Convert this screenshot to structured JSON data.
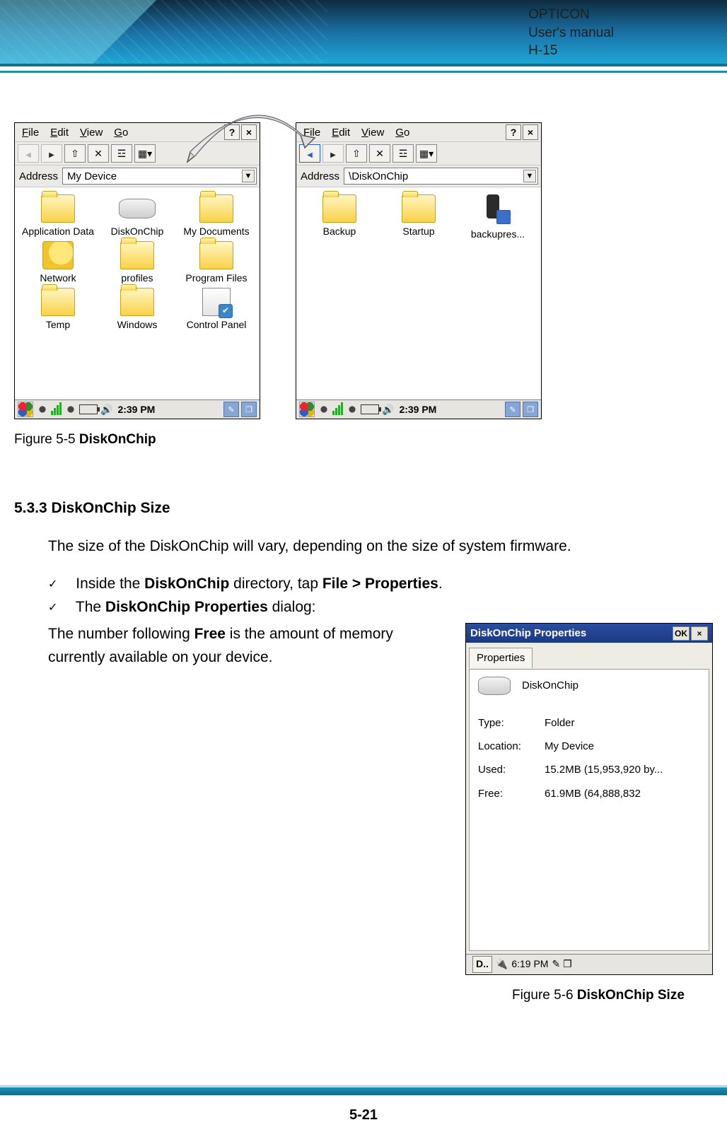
{
  "header": {
    "line1": "OPTICON",
    "line2": "User's manual",
    "line3": "H-15"
  },
  "explorer_left": {
    "menu": {
      "file": "File",
      "edit": "Edit",
      "view": "View",
      "go": "Go"
    },
    "address_label": "Address",
    "address_value": "My Device",
    "items": [
      {
        "label": "Application Data",
        "kind": "folder",
        "selected": true
      },
      {
        "label": "DiskOnChip",
        "kind": "disk"
      },
      {
        "label": "My Documents",
        "kind": "folder"
      },
      {
        "label": "Network",
        "kind": "net"
      },
      {
        "label": "profiles",
        "kind": "folder"
      },
      {
        "label": "Program Files",
        "kind": "folder"
      },
      {
        "label": "Temp",
        "kind": "folder"
      },
      {
        "label": "Windows",
        "kind": "folder"
      },
      {
        "label": "Control Panel",
        "kind": "cpanel"
      }
    ],
    "taskbar_time": "2:39 PM"
  },
  "explorer_right": {
    "menu": {
      "file": "File",
      "edit": "Edit",
      "view": "View",
      "go": "Go"
    },
    "address_label": "Address",
    "address_value": "\\DiskOnChip",
    "items": [
      {
        "label": "Backup",
        "kind": "folder",
        "selected": true
      },
      {
        "label": "Startup",
        "kind": "folder"
      },
      {
        "label": "backupres...",
        "kind": "device"
      }
    ],
    "taskbar_time": "2:39 PM"
  },
  "figure55_prefix": "Figure 5-5 ",
  "figure55_bold": "DiskOnChip",
  "section": {
    "heading": "5.3.3 DiskOnChip Size",
    "intro": "The size of the DiskOnChip will vary, depending on the size of system firmware.",
    "step1_pre": "Inside the ",
    "step1_b1": "DiskOnChip",
    "step1_mid": " directory, tap ",
    "step1_b2": "File > Properties",
    "step1_post": ".",
    "step2_pre": "The ",
    "step2_b1": "DiskOnChip Properties",
    "step2_post": " dialog:",
    "para_pre": "The number following ",
    "para_b": "Free",
    "para_post": " is the amount of memory currently available on your device."
  },
  "dialog": {
    "title": "DiskOnChip Properties",
    "ok": "OK",
    "tab": "Properties",
    "name": "DiskOnChip",
    "type_lbl": "Type:",
    "type_val": "Folder",
    "loc_lbl": "Location:",
    "loc_val": "My Device",
    "used_lbl": "Used:",
    "used_val": "15.2MB (15,953,920 by...",
    "free_lbl": "Free:",
    "free_val": "61.9MB (64,888,832",
    "taskbar_app": "D..",
    "taskbar_time": "6:19 PM"
  },
  "figure56_prefix": "Figure 5-6 ",
  "figure56_bold": "DiskOnChip Size",
  "page_number": "5-21"
}
